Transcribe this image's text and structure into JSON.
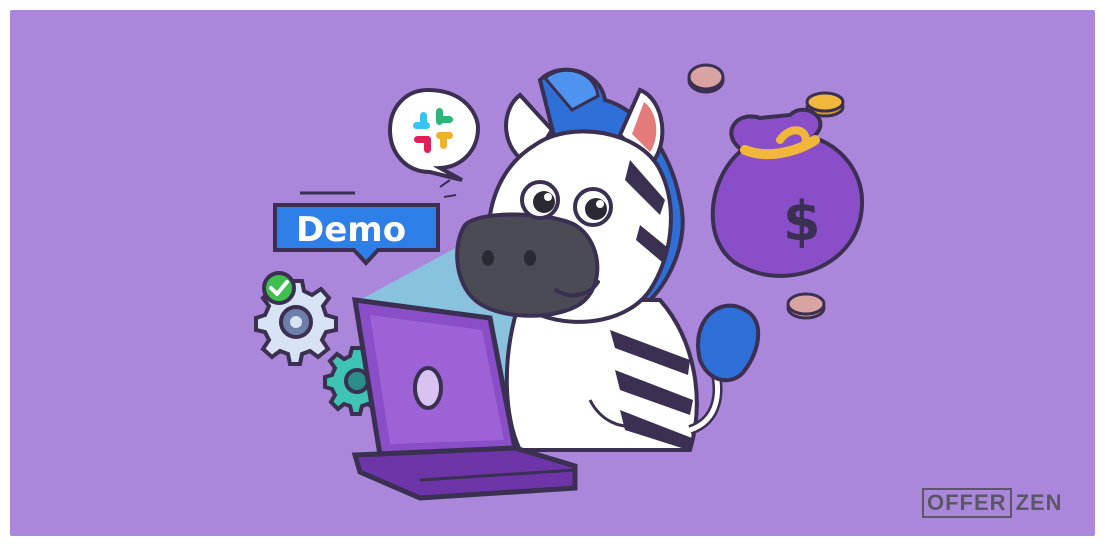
{
  "banner": {
    "demo_label": "Demo",
    "logo": {
      "part1": "OFFER",
      "part2": "ZEN"
    },
    "icons": [
      "slack-icon",
      "gear-icon",
      "check-icon",
      "dollar-icon",
      "laptop-icon"
    ]
  },
  "colors": {
    "background": "#ab87dc",
    "accent_blue": "#2f7fe8",
    "laptop_purple": "#8a4ec8",
    "outline": "#3b2f52",
    "glow": "#6cf2e0",
    "money_bag": "#8a4ec8",
    "coin": "#f1b73c"
  }
}
